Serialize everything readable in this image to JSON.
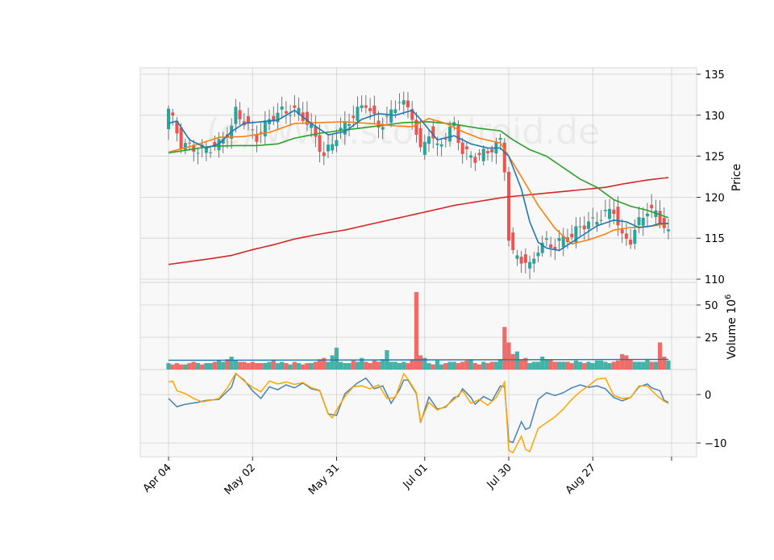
{
  "chart_data": {
    "type": "candlestick",
    "watermark": "(c) www.stockdroid.de",
    "x_labels": [
      "Apr 04",
      "May 02",
      "May 31",
      "Jul 01",
      "Jul 30",
      "Aug 27"
    ],
    "x_label_indices": [
      0,
      20,
      40,
      61,
      81,
      101
    ],
    "colors": {
      "up": "#26a69a",
      "down": "#ef5350",
      "sma_short": "#1f77b4",
      "sma_mid": "#ff7f0e",
      "sma_long": "#2ca02c",
      "sma_200": "#d62728",
      "macd": "#4682b4",
      "signal": "#ffa500",
      "volume_ma": "#1f77b4",
      "panel_bg": "#f8f8f8",
      "grid": "#d0d0d0"
    },
    "price_panel": {
      "ylabel": "Price",
      "ylim": [
        110,
        135
      ],
      "ticks": [
        110,
        115,
        120,
        125,
        130,
        135
      ],
      "ohlc_keyframes": [
        [
          0,
          130.8
        ],
        [
          3,
          126.5
        ],
        [
          8,
          125.6
        ],
        [
          12,
          126.5
        ],
        [
          15,
          128.5
        ],
        [
          16,
          130.5
        ],
        [
          18,
          129.2
        ],
        [
          21,
          127.3
        ],
        [
          24,
          129.5
        ],
        [
          27,
          130.5
        ],
        [
          31,
          130.5
        ],
        [
          34,
          128.4
        ],
        [
          37,
          125.0
        ],
        [
          40,
          127.5
        ],
        [
          44,
          130.0
        ],
        [
          47,
          131.5
        ],
        [
          50,
          128.6
        ],
        [
          53,
          130.2
        ],
        [
          55,
          132.0
        ],
        [
          58,
          130.0
        ],
        [
          60,
          125.5
        ],
        [
          62,
          128.0
        ],
        [
          64,
          126.0
        ],
        [
          66,
          127.5
        ],
        [
          68,
          128.8
        ],
        [
          70,
          125.5
        ],
        [
          73,
          124.8
        ],
        [
          76,
          125.6
        ],
        [
          79,
          126.8
        ],
        [
          80,
          123.5
        ],
        [
          81,
          115.0
        ],
        [
          82,
          113.0
        ],
        [
          84,
          112.5
        ],
        [
          86,
          111.5
        ],
        [
          88,
          113.8
        ],
        [
          90,
          114.5
        ],
        [
          92,
          114.0
        ],
        [
          94,
          115.0
        ],
        [
          96,
          115.2
        ],
        [
          98,
          116.5
        ],
        [
          101,
          117.0
        ],
        [
          104,
          118.0
        ],
        [
          106,
          118.5
        ],
        [
          108,
          115.0
        ],
        [
          110,
          114.8
        ],
        [
          112,
          117.0
        ],
        [
          114,
          118.5
        ],
        [
          116,
          118.0
        ],
        [
          118,
          116.5
        ],
        [
          119,
          115.5
        ]
      ],
      "sma_short_keyframes": [
        [
          0,
          129.0
        ],
        [
          2,
          129.3
        ],
        [
          5,
          127.0
        ],
        [
          9,
          126.0
        ],
        [
          12,
          126.5
        ],
        [
          15,
          128.0
        ],
        [
          18,
          129.0
        ],
        [
          22,
          129.2
        ],
        [
          26,
          129.4
        ],
        [
          30,
          130.6
        ],
        [
          34,
          129.0
        ],
        [
          38,
          127.6
        ],
        [
          42,
          128.0
        ],
        [
          46,
          129.5
        ],
        [
          50,
          130.2
        ],
        [
          54,
          130.0
        ],
        [
          58,
          130.6
        ],
        [
          60,
          129.5
        ],
        [
          64,
          127.0
        ],
        [
          68,
          127.5
        ],
        [
          72,
          126.5
        ],
        [
          76,
          126.0
        ],
        [
          79,
          126.0
        ],
        [
          81,
          125.0
        ],
        [
          84,
          121.0
        ],
        [
          86,
          117.0
        ],
        [
          88,
          114.5
        ],
        [
          90,
          113.8
        ],
        [
          93,
          113.5
        ],
        [
          96,
          114.5
        ],
        [
          99,
          115.5
        ],
        [
          102,
          116.5
        ],
        [
          106,
          117.2
        ],
        [
          109,
          117.0
        ],
        [
          112,
          116.3
        ],
        [
          115,
          116.5
        ],
        [
          117,
          116.8
        ],
        [
          119,
          116.8
        ]
      ],
      "sma_mid_keyframes": [
        [
          0,
          125.5
        ],
        [
          6,
          126.3
        ],
        [
          12,
          127.3
        ],
        [
          18,
          127.4
        ],
        [
          24,
          127.9
        ],
        [
          30,
          129.0
        ],
        [
          36,
          129.1
        ],
        [
          42,
          129.2
        ],
        [
          48,
          129.0
        ],
        [
          54,
          128.7
        ],
        [
          58,
          128.6
        ],
        [
          62,
          129.6
        ],
        [
          66,
          129.0
        ],
        [
          70,
          128.0
        ],
        [
          74,
          127.2
        ],
        [
          79,
          126.6
        ],
        [
          81,
          125.0
        ],
        [
          84,
          122.5
        ],
        [
          88,
          119.0
        ],
        [
          92,
          116.2
        ],
        [
          96,
          114.3
        ],
        [
          100,
          114.8
        ],
        [
          104,
          115.5
        ],
        [
          106,
          116.0
        ],
        [
          110,
          116.3
        ],
        [
          114,
          116.4
        ],
        [
          119,
          116.8
        ]
      ],
      "sma_long_keyframes": [
        [
          0,
          125.4
        ],
        [
          5,
          125.8
        ],
        [
          10,
          126.2
        ],
        [
          16,
          126.3
        ],
        [
          21,
          126.3
        ],
        [
          26,
          126.5
        ],
        [
          30,
          127.2
        ],
        [
          36,
          127.8
        ],
        [
          42,
          128.2
        ],
        [
          50,
          128.7
        ],
        [
          56,
          129.1
        ],
        [
          62,
          129.2
        ],
        [
          68,
          128.9
        ],
        [
          74,
          128.4
        ],
        [
          79,
          128.1
        ],
        [
          82,
          127.0
        ],
        [
          86,
          125.8
        ],
        [
          90,
          125.0
        ],
        [
          94,
          123.6
        ],
        [
          98,
          122.2
        ],
        [
          102,
          121.2
        ],
        [
          106,
          119.7
        ],
        [
          110,
          118.9
        ],
        [
          114,
          118.4
        ],
        [
          119,
          117.5
        ]
      ],
      "sma_200_keyframes": [
        [
          0,
          111.8
        ],
        [
          10,
          112.5
        ],
        [
          15,
          112.9
        ],
        [
          20,
          113.6
        ],
        [
          25,
          114.2
        ],
        [
          30,
          114.9
        ],
        [
          36,
          115.5
        ],
        [
          42,
          116.0
        ],
        [
          48,
          116.7
        ],
        [
          55,
          117.5
        ],
        [
          62,
          118.3
        ],
        [
          68,
          119.0
        ],
        [
          74,
          119.5
        ],
        [
          80,
          120.0
        ],
        [
          86,
          120.3
        ],
        [
          92,
          120.6
        ],
        [
          98,
          120.9
        ],
        [
          104,
          121.2
        ],
        [
          108,
          121.6
        ],
        [
          114,
          122.1
        ],
        [
          119,
          122.4
        ]
      ]
    },
    "volume_panel": {
      "ylabel": "Volume 10^6",
      "ylim": [
        0,
        60
      ],
      "ticks": [
        25,
        50
      ],
      "ma_level": 7.2,
      "values": [
        5,
        4,
        5,
        4,
        4,
        5,
        6,
        5,
        4,
        5,
        5,
        6,
        7,
        6,
        8,
        10,
        7,
        6,
        6,
        5,
        6,
        5,
        5,
        5,
        6,
        7,
        5,
        6,
        5,
        4,
        6,
        5,
        4,
        5,
        5,
        6,
        8,
        9,
        6,
        11,
        17,
        6,
        5,
        5,
        7,
        6,
        9,
        6,
        5,
        7,
        6,
        8,
        15,
        6,
        6,
        5,
        6,
        5,
        8,
        60,
        11,
        9,
        5,
        4,
        7,
        4,
        5,
        6,
        6,
        5,
        6,
        7,
        8,
        5,
        4,
        6,
        5,
        6,
        6,
        8,
        33,
        21,
        12,
        14,
        8,
        9,
        5,
        6,
        6,
        10,
        8,
        8,
        6,
        6,
        6,
        6,
        5,
        7,
        6,
        5,
        6,
        5,
        7,
        7,
        6,
        5,
        6,
        7,
        12,
        11,
        8,
        6,
        6,
        6,
        8,
        6,
        6,
        21,
        10,
        7
      ]
    },
    "macd_panel": {
      "ylim": [
        -12.5,
        6
      ],
      "ticks": [
        -10,
        0
      ],
      "macd_keyframes": [
        [
          0,
          -0.8
        ],
        [
          2,
          -2.5
        ],
        [
          4,
          -2.0
        ],
        [
          7,
          -1.6
        ],
        [
          9,
          -1.2
        ],
        [
          12,
          -1.0
        ],
        [
          15,
          1.5
        ],
        [
          16,
          4.3
        ],
        [
          18,
          3.0
        ],
        [
          20,
          0.8
        ],
        [
          22,
          -0.8
        ],
        [
          24,
          1.6
        ],
        [
          26,
          1.0
        ],
        [
          28,
          2.0
        ],
        [
          30,
          1.4
        ],
        [
          32,
          2.4
        ],
        [
          34,
          1.2
        ],
        [
          36,
          0.8
        ],
        [
          38,
          -4.0
        ],
        [
          40,
          -4.3
        ],
        [
          42,
          0.2
        ],
        [
          45,
          2.4
        ],
        [
          47,
          3.4
        ],
        [
          49,
          1.2
        ],
        [
          51,
          1.8
        ],
        [
          53,
          -1.8
        ],
        [
          55,
          1.0
        ],
        [
          56,
          3.0
        ],
        [
          57,
          3.0
        ],
        [
          59,
          0.2
        ],
        [
          60,
          -5.8
        ],
        [
          62,
          -0.5
        ],
        [
          64,
          -3.0
        ],
        [
          66,
          -2.6
        ],
        [
          68,
          -0.6
        ],
        [
          69,
          -0.4
        ],
        [
          70,
          1.2
        ],
        [
          72,
          -0.6
        ],
        [
          73,
          -2.0
        ],
        [
          75,
          -0.4
        ],
        [
          77,
          -1.3
        ],
        [
          79,
          1.8
        ],
        [
          80,
          1.6
        ],
        [
          81,
          -9.6
        ],
        [
          82,
          -9.9
        ],
        [
          84,
          -5.6
        ],
        [
          85,
          -7.2
        ],
        [
          86,
          -6.8
        ],
        [
          88,
          -1.0
        ],
        [
          90,
          0.4
        ],
        [
          92,
          -0.2
        ],
        [
          94,
          0.4
        ],
        [
          96,
          1.4
        ],
        [
          98,
          2.0
        ],
        [
          100,
          1.5
        ],
        [
          102,
          1.8
        ],
        [
          104,
          1.2
        ],
        [
          106,
          -0.6
        ],
        [
          108,
          -1.3
        ],
        [
          110,
          -0.6
        ],
        [
          112,
          1.6
        ],
        [
          114,
          2.2
        ],
        [
          115,
          1.4
        ],
        [
          117,
          0.8
        ],
        [
          118,
          -1.2
        ],
        [
          119,
          -1.6
        ]
      ],
      "signal_keyframes": [
        [
          0,
          2.6
        ],
        [
          1,
          2.8
        ],
        [
          2,
          0.8
        ],
        [
          4,
          0.2
        ],
        [
          6,
          -0.8
        ],
        [
          8,
          -1.5
        ],
        [
          10,
          -1.2
        ],
        [
          12,
          -0.8
        ],
        [
          14,
          1.4
        ],
        [
          16,
          4.4
        ],
        [
          18,
          2.8
        ],
        [
          20,
          1.5
        ],
        [
          22,
          0.6
        ],
        [
          24,
          2.8
        ],
        [
          26,
          2.2
        ],
        [
          28,
          2.6
        ],
        [
          30,
          2.1
        ],
        [
          32,
          2.5
        ],
        [
          34,
          1.4
        ],
        [
          36,
          0.9
        ],
        [
          38,
          -4.0
        ],
        [
          39,
          -4.8
        ],
        [
          40,
          -3.2
        ],
        [
          42,
          -0.4
        ],
        [
          44,
          1.6
        ],
        [
          46,
          1.8
        ],
        [
          48,
          1.2
        ],
        [
          50,
          2.0
        ],
        [
          52,
          -0.8
        ],
        [
          54,
          -0.6
        ],
        [
          56,
          4.3
        ],
        [
          57,
          3.2
        ],
        [
          59,
          0.4
        ],
        [
          60,
          -5.6
        ],
        [
          62,
          -1.6
        ],
        [
          64,
          -3.2
        ],
        [
          66,
          -2.4
        ],
        [
          68,
          -1.0
        ],
        [
          70,
          0.8
        ],
        [
          72,
          -1.8
        ],
        [
          74,
          -1.0
        ],
        [
          76,
          -2.2
        ],
        [
          78,
          -0.6
        ],
        [
          80,
          2.6
        ],
        [
          81,
          -11.5
        ],
        [
          82,
          -12.0
        ],
        [
          84,
          -8.6
        ],
        [
          85,
          -11.3
        ],
        [
          86,
          -11.8
        ],
        [
          88,
          -7.0
        ],
        [
          90,
          -5.8
        ],
        [
          92,
          -4.6
        ],
        [
          94,
          -3.0
        ],
        [
          96,
          -1.0
        ],
        [
          98,
          0.6
        ],
        [
          100,
          1.8
        ],
        [
          102,
          3.2
        ],
        [
          104,
          3.4
        ],
        [
          106,
          -0.2
        ],
        [
          108,
          -0.8
        ],
        [
          110,
          -0.6
        ],
        [
          112,
          1.8
        ],
        [
          114,
          1.8
        ],
        [
          116,
          0.0
        ],
        [
          118,
          -1.4
        ],
        [
          119,
          -1.8
        ]
      ]
    }
  }
}
